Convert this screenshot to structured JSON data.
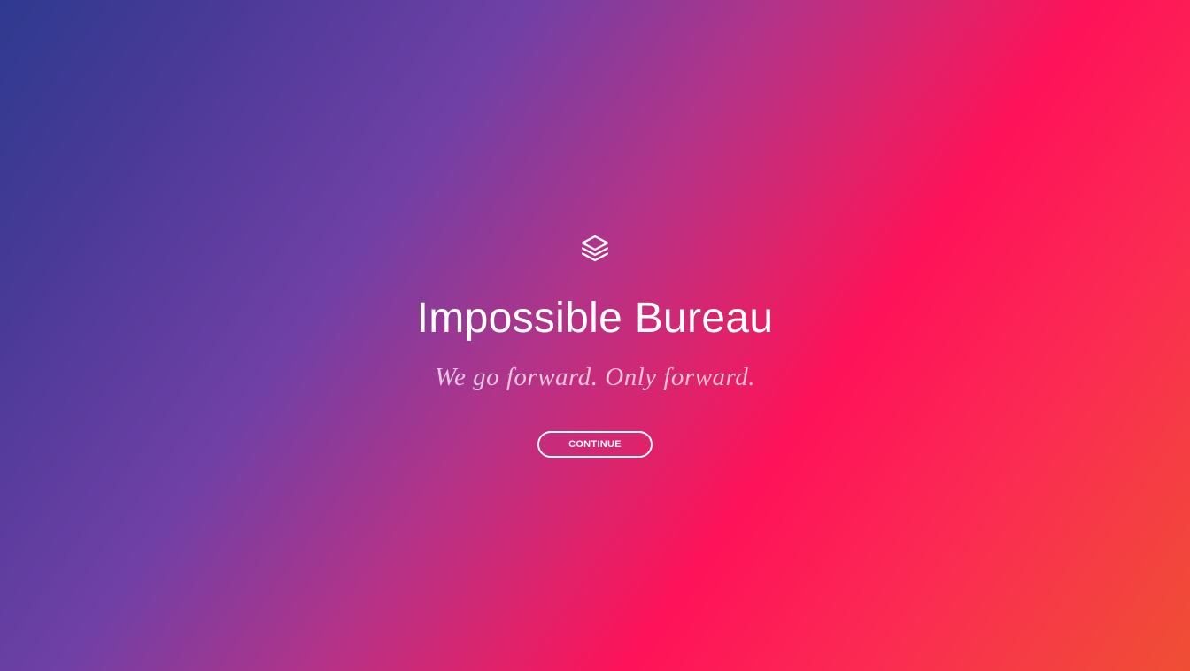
{
  "hero": {
    "logo_icon": "layers-icon",
    "title": "Impossible Bureau",
    "tagline": "We go forward. Only forward.",
    "cta_label": "CONTINUE"
  },
  "theme": {
    "gradient_start": "#2e3a8f",
    "gradient_mid": "#7040a6",
    "gradient_pink": "#fe1259",
    "gradient_end": "#ef4f34",
    "text_color": "#ffffff"
  }
}
